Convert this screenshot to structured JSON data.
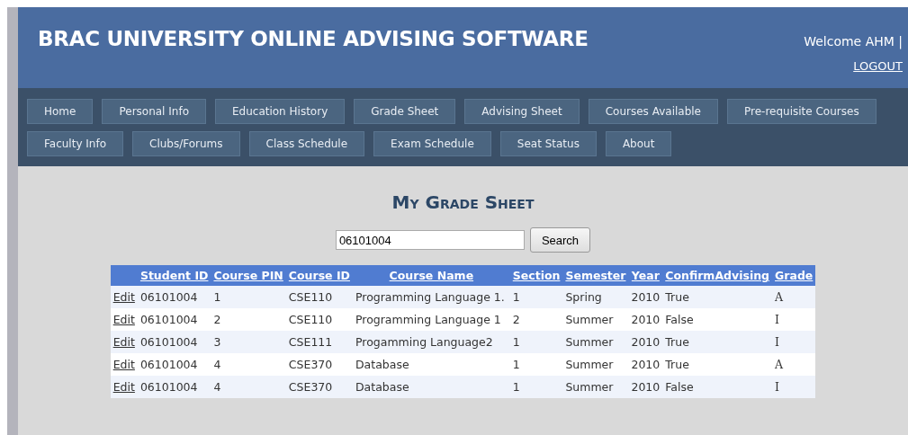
{
  "header": {
    "title": "BRAC UNIVERSITY ONLINE ADVISING SOFTWARE",
    "welcome": "Welcome AHM |",
    "logout": "LOGOUT"
  },
  "nav_rows": [
    [
      "Home",
      "Personal Info",
      "Education History",
      "Grade Sheet",
      "Advising Sheet",
      "Courses Available",
      "Pre-requisite Courses"
    ],
    [
      "Faculty Info",
      "Clubs/Forums",
      "Class Schedule",
      "Exam Schedule",
      "Seat Status",
      "About"
    ]
  ],
  "page_title": "My Grade Sheet",
  "search": {
    "value": "06101004",
    "button": "Search"
  },
  "table": {
    "columns": [
      "Student ID",
      "Course PIN",
      "Course ID",
      "Course Name",
      "Section",
      "Semester",
      "Year",
      "ConfirmAdvising",
      "Grade"
    ],
    "rows": [
      {
        "action": "Edit",
        "cells": [
          "06101004",
          "1",
          "CSE110",
          "Programming Language 1.",
          "1",
          "Spring",
          "2010",
          "True",
          "A"
        ]
      },
      {
        "action": "Edit",
        "cells": [
          "06101004",
          "2",
          "CSE110",
          "Programming Language 1",
          "2",
          "Summer",
          "2010",
          "False",
          "I"
        ]
      },
      {
        "action": "Edit",
        "cells": [
          "06101004",
          "3",
          "CSE111",
          "Progamming Language2",
          "1",
          "Summer",
          "2010",
          "True",
          "I"
        ]
      },
      {
        "action": "Edit",
        "cells": [
          "06101004",
          "4",
          "CSE370",
          "Database",
          "1",
          "Summer",
          "2010",
          "True",
          "A"
        ]
      },
      {
        "action": "Edit",
        "cells": [
          "06101004",
          "4",
          "CSE370",
          "Database",
          "1",
          "Summer",
          "2010",
          "False",
          "I"
        ]
      }
    ]
  }
}
